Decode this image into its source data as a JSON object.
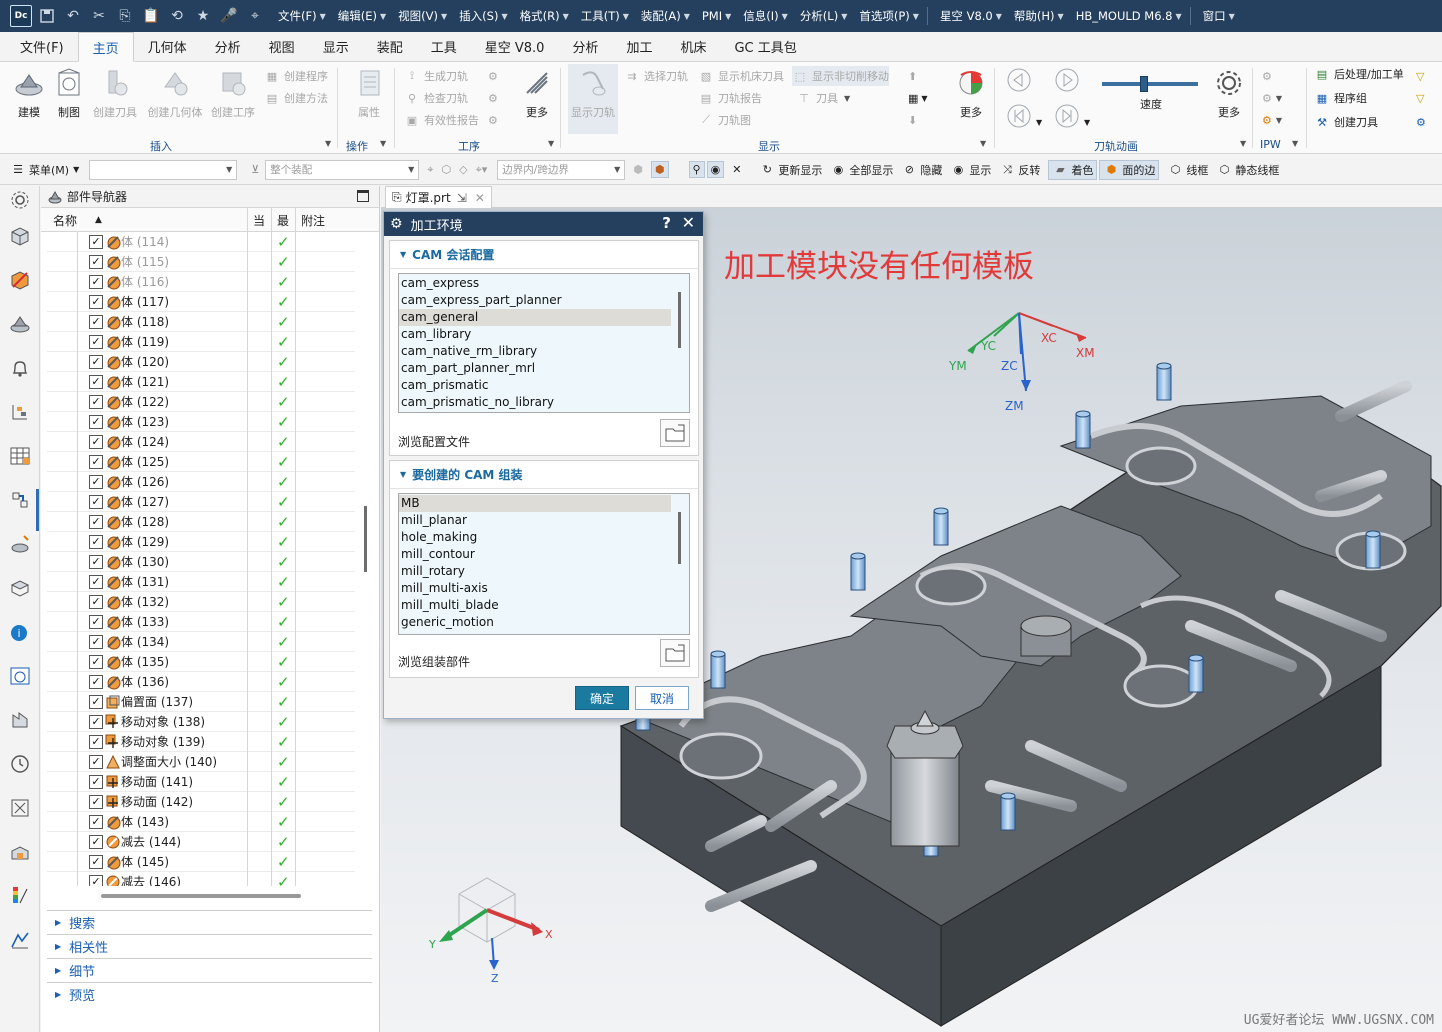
{
  "titlebar": {
    "logo": "Dc",
    "menus": [
      "文件(F)",
      "编辑(E)",
      "视图(V)",
      "插入(S)",
      "格式(R)",
      "工具(T)",
      "装配(A)",
      "PMI",
      "信息(I)",
      "分析(L)",
      "首选项(P)",
      "星空 V8.0",
      "帮助(H)",
      "HB_MOULD M6.8",
      "窗口"
    ],
    "accent": "#24405e"
  },
  "ribbon_tabs": [
    "文件(F)",
    "主页",
    "几何体",
    "分析",
    "视图",
    "显示",
    "装配",
    "工具",
    "星空 V8.0",
    "分析",
    "加工",
    "机床",
    "GC 工具包"
  ],
  "ribbon": {
    "big_buttons": [
      "建模",
      "制图",
      "创建刀具",
      "创建几何体",
      "创建工序",
      "属性",
      "更多",
      "显示刀轨",
      "更多",
      "更多"
    ],
    "small_create": [
      "创建程序",
      "创建方法"
    ],
    "small_ops": [
      "生成刀轨",
      "检查刀轨",
      "有效性报告"
    ],
    "small_display": [
      "选择刀轨",
      "显示机床刀具",
      "显示非切削移动",
      "刀轨报告",
      "刀具",
      "刀轨图"
    ],
    "speed_label": "速度",
    "right_items": [
      "后处理/加工单",
      "程序组",
      "创建刀具"
    ],
    "group_labels": [
      "插入",
      "操作",
      "工序",
      "显示",
      "刀轨动画",
      "IPW"
    ]
  },
  "toolbar2": {
    "menu": "菜单(M)",
    "filter_placeholder": "",
    "assembly_placeholder": "整个装配",
    "boundary_placeholder": "边界内/跨边界",
    "buttons": [
      "更新显示",
      "全部显示",
      "隐藏",
      "显示",
      "反转",
      "着色",
      "面的边",
      "线框",
      "静态线框"
    ]
  },
  "navigator": {
    "title": "部件导航器",
    "col_name": "名称",
    "col_current": "当",
    "col_latest": "最",
    "col_note": "附注",
    "rows": [
      {
        "label": "体 (114)",
        "type": "body",
        "gray": true
      },
      {
        "label": "体 (115)",
        "type": "body",
        "gray": true
      },
      {
        "label": "体 (116)",
        "type": "body",
        "gray": true
      },
      {
        "label": "体 (117)",
        "type": "body",
        "gray": false
      },
      {
        "label": "体 (118)",
        "type": "body",
        "gray": false
      },
      {
        "label": "体 (119)",
        "type": "body",
        "gray": false
      },
      {
        "label": "体 (120)",
        "type": "body",
        "gray": false
      },
      {
        "label": "体 (121)",
        "type": "body",
        "gray": false
      },
      {
        "label": "体 (122)",
        "type": "body",
        "gray": false
      },
      {
        "label": "体 (123)",
        "type": "body",
        "gray": false
      },
      {
        "label": "体 (124)",
        "type": "body",
        "gray": false
      },
      {
        "label": "体 (125)",
        "type": "body",
        "gray": false
      },
      {
        "label": "体 (126)",
        "type": "body",
        "gray": false
      },
      {
        "label": "体 (127)",
        "type": "body",
        "gray": false
      },
      {
        "label": "体 (128)",
        "type": "body",
        "gray": false
      },
      {
        "label": "体 (129)",
        "type": "body",
        "gray": false
      },
      {
        "label": "体 (130)",
        "type": "body",
        "gray": false
      },
      {
        "label": "体 (131)",
        "type": "body",
        "gray": false
      },
      {
        "label": "体 (132)",
        "type": "body",
        "gray": false
      },
      {
        "label": "体 (133)",
        "type": "body",
        "gray": false
      },
      {
        "label": "体 (134)",
        "type": "body",
        "gray": false
      },
      {
        "label": "体 (135)",
        "type": "body",
        "gray": false
      },
      {
        "label": "体 (136)",
        "type": "body",
        "gray": false
      },
      {
        "label": "偏置面 (137)",
        "type": "offset",
        "gray": false
      },
      {
        "label": "移动对象 (138)",
        "type": "move",
        "gray": false
      },
      {
        "label": "移动对象 (139)",
        "type": "move",
        "gray": false
      },
      {
        "label": "调整面大小 (140)",
        "type": "resize",
        "gray": false
      },
      {
        "label": "移动面 (141)",
        "type": "moveface",
        "gray": false
      },
      {
        "label": "移动面 (142)",
        "type": "moveface",
        "gray": false
      },
      {
        "label": "体 (143)",
        "type": "body",
        "gray": false
      },
      {
        "label": "减去 (144)",
        "type": "subtract",
        "gray": false
      },
      {
        "label": "体 (145)",
        "type": "body",
        "gray": false
      },
      {
        "label": "减去 (146)",
        "type": "subtract",
        "gray": false
      }
    ],
    "panels": [
      "搜索",
      "相关性",
      "细节",
      "预览"
    ]
  },
  "graphics": {
    "tab_label": "灯罩.prt",
    "annotation": "加工模块没有任何模板",
    "watermark": "UG爱好者论坛 WWW.UGSNX.COM",
    "csys_labels": [
      "XC",
      "YC",
      "ZC",
      "XM",
      "YM",
      "ZM"
    ],
    "triad_labels": [
      "X",
      "Y",
      "Z"
    ]
  },
  "dialog": {
    "title": "加工环境",
    "help": "?",
    "section1_title": "CAM 会话配置",
    "configs": [
      "cam_express",
      "cam_express_part_planner",
      "cam_general",
      "cam_library",
      "cam_native_rm_library",
      "cam_part_planner_mrl",
      "cam_prismatic",
      "cam_prismatic_no_library"
    ],
    "config_selected": "cam_general",
    "browse_config": "浏览配置文件",
    "section2_title": "要创建的 CAM 组装",
    "setups": [
      "MB",
      "mill_planar",
      "hole_making",
      "mill_contour",
      "mill_rotary",
      "mill_multi-axis",
      "mill_multi_blade",
      "generic_motion"
    ],
    "setup_selected": "MB",
    "browse_setup": "浏览组装部件",
    "ok": "确定",
    "cancel": "取消",
    "ok_color": "#1b7aa0"
  }
}
